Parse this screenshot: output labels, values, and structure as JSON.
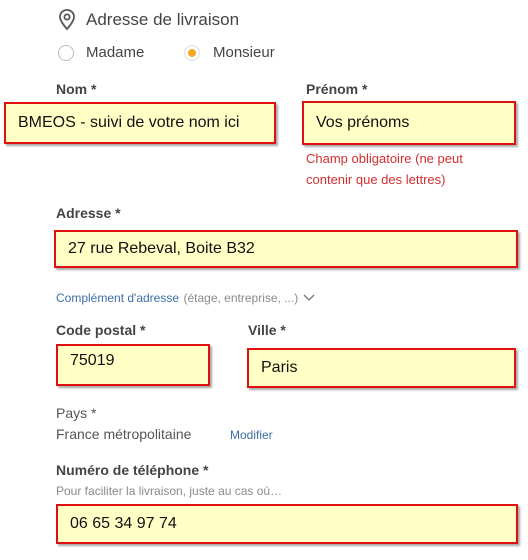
{
  "section": {
    "title": "Adresse de livraison",
    "icon": "location-pin-icon"
  },
  "civility": {
    "options": [
      {
        "label": "Madame",
        "checked": false
      },
      {
        "label": "Monsieur",
        "checked": true
      }
    ]
  },
  "fields": {
    "nom": {
      "label": "Nom *",
      "value": "BMEOS - suivi de votre nom ici"
    },
    "prenom": {
      "label": "Prénom *",
      "value": "Vos prénoms",
      "error": [
        "Champ obligatoire (ne peut",
        "contenir que des lettres)"
      ]
    },
    "adresse": {
      "label": "Adresse *",
      "value": "27 rue Rebeval, Boite B32"
    },
    "complement": {
      "link": "Complément d'adresse",
      "hint": "(étage, entreprise, ...)"
    },
    "code_postal": {
      "label": "Code postal *",
      "value": "75019"
    },
    "ville": {
      "label": "Ville *",
      "value": "Paris"
    },
    "pays": {
      "label": "Pays *",
      "value": "France métropolitaine",
      "action": "Modifier"
    },
    "telephone": {
      "label": "Numéro de téléphone *",
      "hint": "Pour faciliter la livraison, juste au cas où…",
      "value": "06 65 34 97 74"
    }
  },
  "colors": {
    "accent": "#f5a623",
    "error": "#d32f2f",
    "highlight": "#ffffc6",
    "border": "#e01010"
  }
}
